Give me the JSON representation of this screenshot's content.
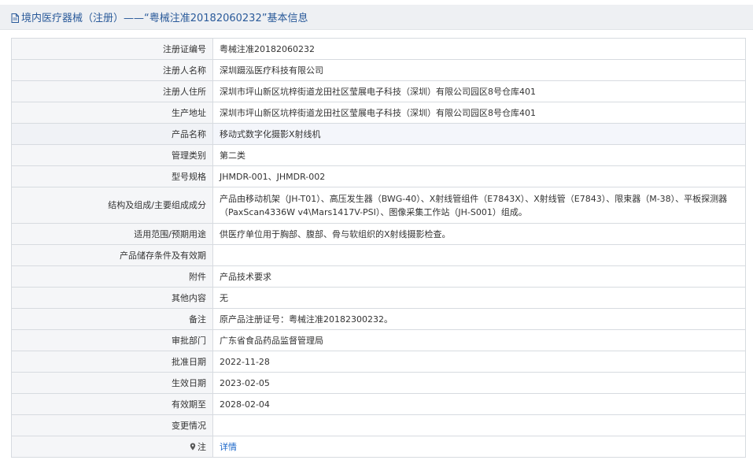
{
  "header": {
    "title": "境内医疗器械（注册）——“粤械注准20182060232”基本信息",
    "icon": "document-icon"
  },
  "rows": [
    {
      "label": "注册证编号",
      "value": "粤械注准20182060232"
    },
    {
      "label": "注册人名称",
      "value": "深圳蹑泓医疗科技有限公司"
    },
    {
      "label": "注册人住所",
      "value": "深圳市坪山新区坑梓街道龙田社区莹展电子科技（深圳）有限公司园区8号仓库401"
    },
    {
      "label": "生产地址",
      "value": "深圳市坪山新区坑梓街道龙田社区莹展电子科技（深圳）有限公司园区8号仓库401"
    },
    {
      "label": "产品名称",
      "value": "移动式数字化摄影X射线机"
    },
    {
      "label": "管理类别",
      "value": "第二类"
    },
    {
      "label": "型号规格",
      "value": "JHMDR-001、JHMDR-002"
    },
    {
      "label": "结构及组成/主要组成成分",
      "value": "产品由移动机架（JH-T01）、高压发生器（BWG-40）、X射线管组件（E7843X）、X射线管（E7843）、限束器（M-38）、平板探测器（PaxScan4336W v4\\Mars1417V-PSI）、图像采集工作站（JH-S001）组成。"
    },
    {
      "label": "适用范围/预期用途",
      "value": "供医疗单位用于胸部、腹部、骨与软组织的X射线摄影检查。"
    },
    {
      "label": "产品储存条件及有效期",
      "value": ""
    },
    {
      "label": "附件",
      "value": "产品技术要求"
    },
    {
      "label": "其他内容",
      "value": "无"
    },
    {
      "label": "备注",
      "value": "原产品注册证号：粤械注准20182300232。"
    },
    {
      "label": "审批部门",
      "value": "广东省食品药品监督管理局"
    },
    {
      "label": "批准日期",
      "value": "2022-11-28"
    },
    {
      "label": "生效日期",
      "value": "2023-02-05"
    },
    {
      "label": "有效期至",
      "value": "2028-02-04"
    },
    {
      "label": "变更情况",
      "value": ""
    },
    {
      "label": "注",
      "value": "详情",
      "icon": "map-pin-icon"
    }
  ]
}
